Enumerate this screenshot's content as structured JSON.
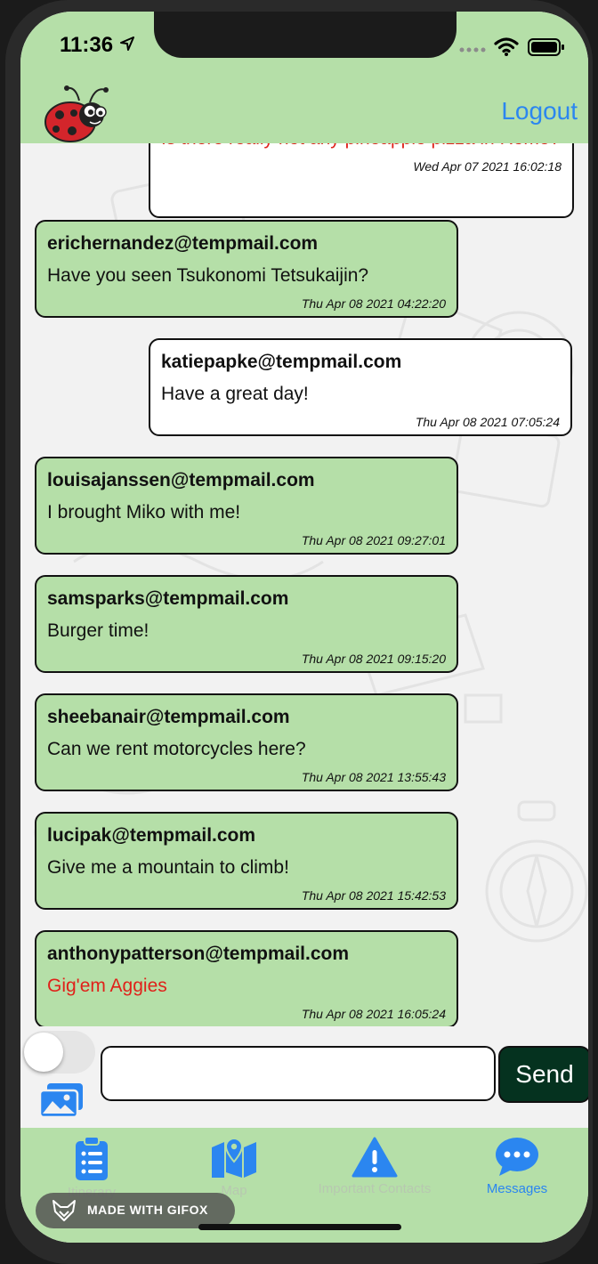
{
  "status_bar": {
    "time": "11:36"
  },
  "header": {
    "logout_label": "Logout"
  },
  "messages": [
    {
      "sender": "",
      "body": "Is there really not any pineapple pizza in Rome?",
      "timestamp": "Wed Apr 07 2021 16:02:18",
      "mine": true,
      "red": true
    },
    {
      "sender": "erichernandez@tempmail.com",
      "body": "Have you seen Tsukonomi Tetsukaijin?",
      "timestamp": "Thu Apr 08 2021 04:22:20",
      "mine": false,
      "red": false
    },
    {
      "sender": "katiepapke@tempmail.com",
      "body": "Have a great day!",
      "timestamp": "Thu Apr 08 2021 07:05:24",
      "mine": true,
      "red": false
    },
    {
      "sender": "louisajanssen@tempmail.com",
      "body": "I brought Miko with me!",
      "timestamp": "Thu Apr 08 2021 09:27:01",
      "mine": false,
      "red": false
    },
    {
      "sender": "samsparks@tempmail.com",
      "body": "Burger time!",
      "timestamp": "Thu Apr 08 2021 09:15:20",
      "mine": false,
      "red": false
    },
    {
      "sender": "sheebanair@tempmail.com",
      "body": "Can we rent motorcycles here?",
      "timestamp": "Thu Apr 08 2021 13:55:43",
      "mine": false,
      "red": false
    },
    {
      "sender": "lucipak@tempmail.com",
      "body": "Give me a mountain to climb!",
      "timestamp": "Thu Apr 08 2021 15:42:53",
      "mine": false,
      "red": false
    },
    {
      "sender": "anthonypatterson@tempmail.com",
      "body": "Gig'em Aggies",
      "timestamp": "Thu Apr 08 2021 16:05:24",
      "mine": false,
      "red": true
    }
  ],
  "composer": {
    "input_value": "",
    "send_label": "Send",
    "toggle_on": false
  },
  "tabs": [
    {
      "label": "Itinerary",
      "icon": "clipboard-list-icon",
      "active": false
    },
    {
      "label": "Map",
      "icon": "map-pin-icon",
      "active": false
    },
    {
      "label": "Important Contacts",
      "icon": "warning-icon",
      "active": false
    },
    {
      "label": "Messages",
      "icon": "chat-bubble-icon",
      "active": true
    }
  ],
  "watermark": {
    "text": "MADE WITH GIFOX"
  },
  "colors": {
    "header_green": "#b5dfa8",
    "accent_blue": "#2b86f0",
    "send_dark_green": "#05321f",
    "alert_red": "#e0211a"
  }
}
